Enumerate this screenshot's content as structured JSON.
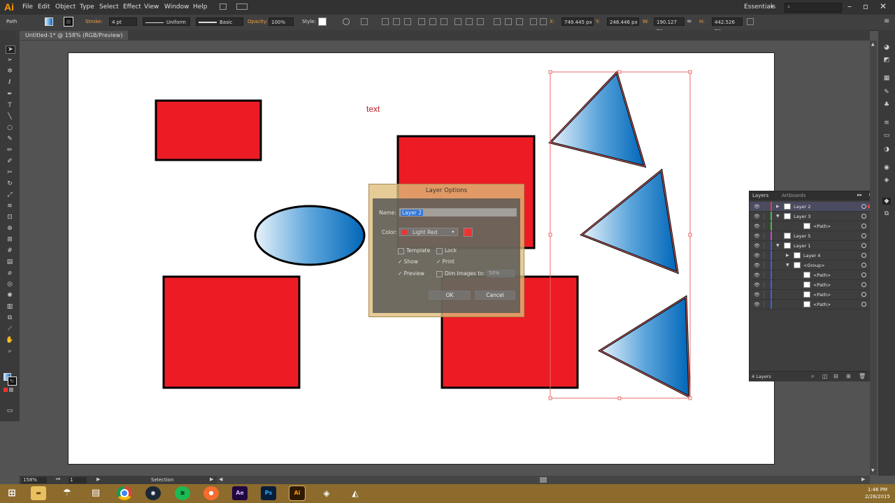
{
  "app": {
    "logo": "Ai",
    "menu": [
      "File",
      "Edit",
      "Object",
      "Type",
      "Select",
      "Effect",
      "View",
      "Window",
      "Help"
    ],
    "workspace": "Essentials"
  },
  "control_bar": {
    "selection_type": "Path",
    "stroke_label": "Stroke:",
    "stroke_weight": "4 pt",
    "profile": "Uniform",
    "brush": "Basic",
    "opacity_label": "Opacity:",
    "opacity": "100%",
    "style_label": "Style:",
    "x_label": "X:",
    "x": "749.445 px",
    "y_label": "Y:",
    "y": "248.446 px",
    "w_label": "W:",
    "w": "190.127 px",
    "h_label": "H:",
    "h": "442.526 px"
  },
  "document": {
    "tab_title": "Untitled-1* @ 158% (RGB/Preview)",
    "artboard_text": "text"
  },
  "colors": {
    "rect_fill": "#ed1c24",
    "gradient_light": "#e8f2fa",
    "gradient_dark": "#0066b8",
    "selection": "#e86a6a"
  },
  "layers_panel": {
    "tab_active": "Layers",
    "tab_inactive": "Artboards",
    "rows": [
      {
        "name": "Layer 2",
        "color": "#e04444",
        "indent": 0,
        "expand": "right",
        "selected": true
      },
      {
        "name": "Layer 3",
        "color": "#44c040",
        "indent": 0,
        "expand": "down",
        "selected": false
      },
      {
        "name": "<Path>",
        "color": "#44c040",
        "indent": 2,
        "expand": "",
        "selected": false
      },
      {
        "name": "Layer 5",
        "color": "#d040d0",
        "indent": 0,
        "expand": "",
        "selected": false
      },
      {
        "name": "Layer 1",
        "color": "#4060e0",
        "indent": 0,
        "expand": "down",
        "selected": false
      },
      {
        "name": "Layer 4",
        "color": "#4060e0",
        "indent": 1,
        "expand": "right",
        "selected": false
      },
      {
        "name": "<Group>",
        "color": "#4060e0",
        "indent": 1,
        "expand": "down",
        "selected": false
      },
      {
        "name": "<Path>",
        "color": "#4060e0",
        "indent": 2,
        "expand": "",
        "selected": false
      },
      {
        "name": "<Path>",
        "color": "#4060e0",
        "indent": 2,
        "expand": "",
        "selected": false
      },
      {
        "name": "<Path>",
        "color": "#4060e0",
        "indent": 2,
        "expand": "",
        "selected": false
      },
      {
        "name": "<Path>",
        "color": "#4060e0",
        "indent": 2,
        "expand": "",
        "selected": false
      }
    ],
    "footer_count": "4 Layers"
  },
  "dialog": {
    "title": "Layer Options",
    "name_label": "Name:",
    "name_value": "Layer 2",
    "color_label": "Color:",
    "color_value": "Light Red",
    "swatch_color": "#ee3333",
    "template": "Template",
    "lock": "Lock",
    "show": "Show",
    "print": "Print",
    "preview": "Preview",
    "dim_images": "Dim Images to:",
    "dim_value": "50%",
    "ok": "OK",
    "cancel": "Cancel"
  },
  "status_bar": {
    "zoom": "158%",
    "artboard_num": "1",
    "tool": "Selection"
  },
  "taskbar": {
    "apps": [
      "Chrome",
      "Steam",
      "Spotify",
      "Origin",
      "Ae",
      "Ps",
      "Ai"
    ],
    "time": "1:46 PM",
    "date": "2/28/2015"
  }
}
